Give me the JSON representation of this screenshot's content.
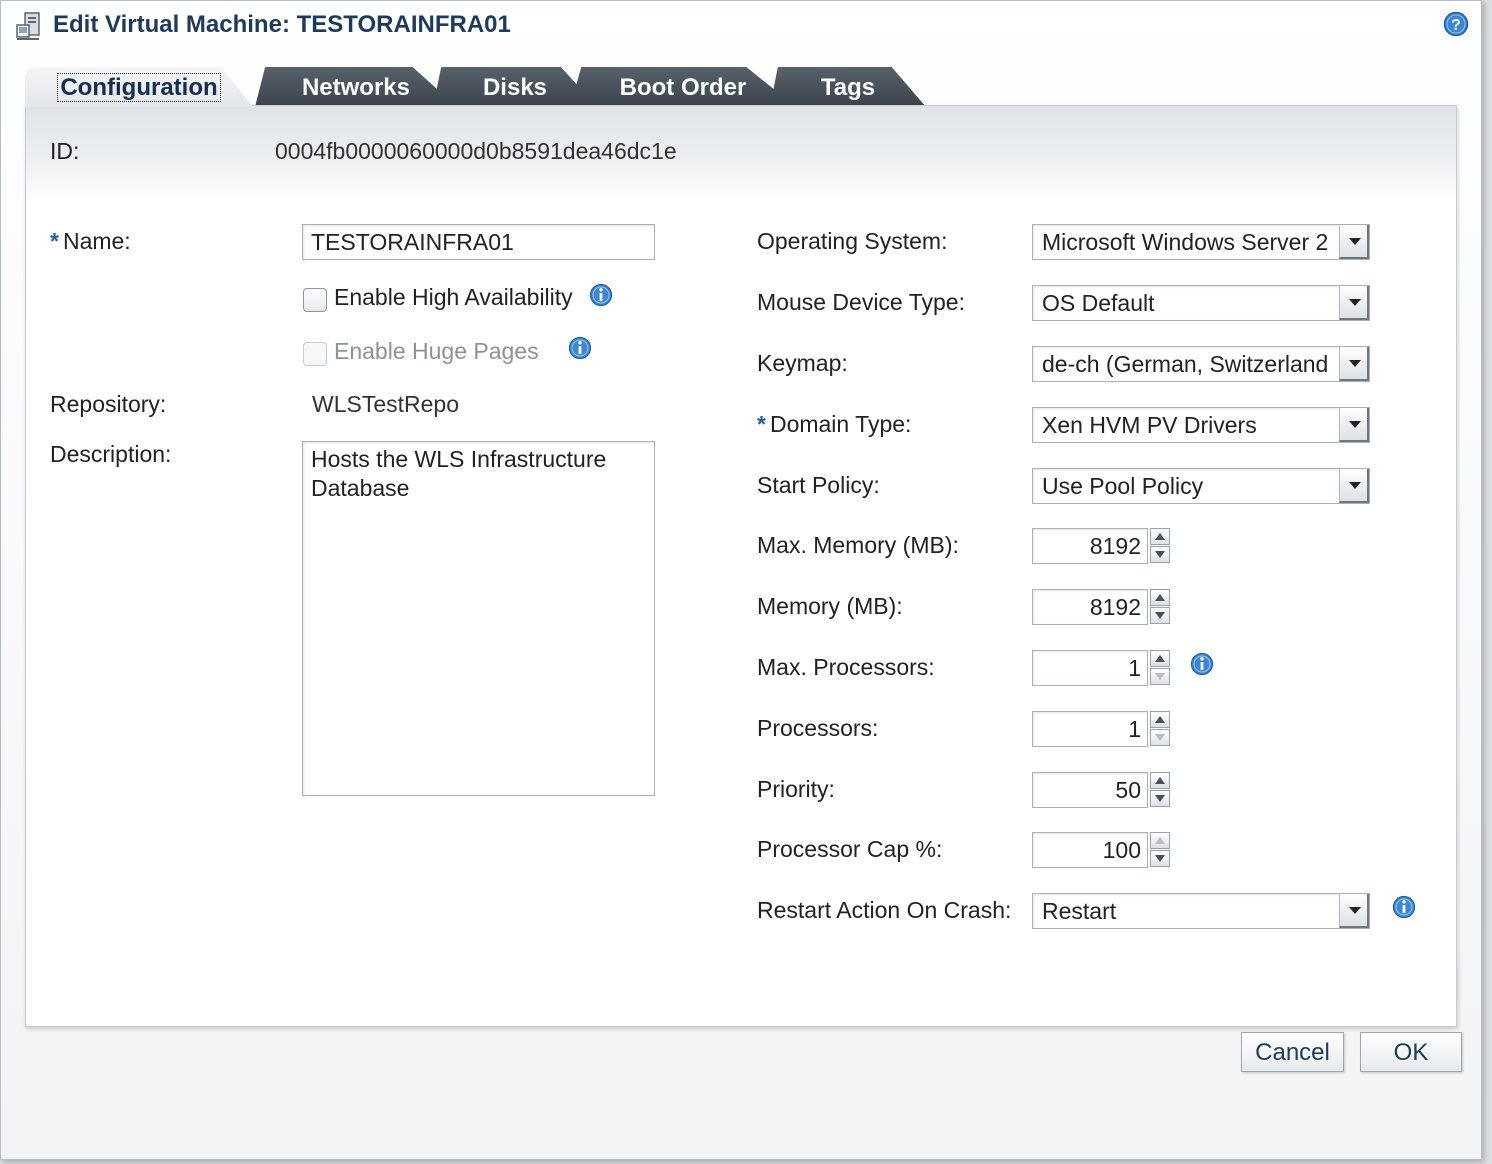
{
  "window": {
    "title": "Edit Virtual Machine: TESTORAINFRA01"
  },
  "tabs": [
    {
      "label": "Configuration",
      "active": true
    },
    {
      "label": "Networks",
      "active": false
    },
    {
      "label": "Disks",
      "active": false
    },
    {
      "label": "Boot Order",
      "active": false
    },
    {
      "label": "Tags",
      "active": false
    }
  ],
  "id_row": {
    "label": "ID:",
    "value": "0004fb0000060000d0b8591dea46dc1e"
  },
  "left": {
    "name": {
      "required_mark": "*",
      "label": "Name:",
      "value": "TESTORAINFRA01"
    },
    "high_availability": {
      "label": "Enable High Availability",
      "checked": false
    },
    "huge_pages": {
      "label": "Enable Huge Pages",
      "checked": false,
      "disabled": true
    },
    "repository": {
      "label": "Repository:",
      "value": "WLSTestRepo"
    },
    "description": {
      "label": "Description:",
      "value": "Hosts the WLS Infrastructure Database"
    }
  },
  "right": {
    "operating_system": {
      "label": "Operating System:",
      "value": "Microsoft Windows Server 2"
    },
    "mouse_device_type": {
      "label": "Mouse Device Type:",
      "value": "OS Default"
    },
    "keymap": {
      "label": "Keymap:",
      "value": "de-ch (German, Switzerland"
    },
    "domain_type": {
      "required_mark": "*",
      "label": "Domain Type:",
      "value": "Xen HVM PV Drivers"
    },
    "start_policy": {
      "label": "Start Policy:",
      "value": "Use Pool Policy"
    },
    "max_memory": {
      "label": "Max. Memory (MB):",
      "value": "8192"
    },
    "memory": {
      "label": "Memory (MB):",
      "value": "8192"
    },
    "max_processors": {
      "label": "Max. Processors:",
      "value": "1"
    },
    "processors": {
      "label": "Processors:",
      "value": "1"
    },
    "priority": {
      "label": "Priority:",
      "value": "50"
    },
    "processor_cap": {
      "label": "Processor Cap %:",
      "value": "100"
    },
    "restart_action": {
      "label": "Restart Action On Crash:",
      "value": "Restart"
    }
  },
  "footer": {
    "cancel_label": "Cancel",
    "ok_label": "OK"
  },
  "colors": {
    "title_text": "#1e3a5a",
    "tab_inactive": "#47505a",
    "required_mark": "#2a5d9a",
    "info_icon": "#2f7fd1"
  },
  "icons": [
    "vm-edit-icon",
    "help-icon",
    "info-icon"
  ]
}
